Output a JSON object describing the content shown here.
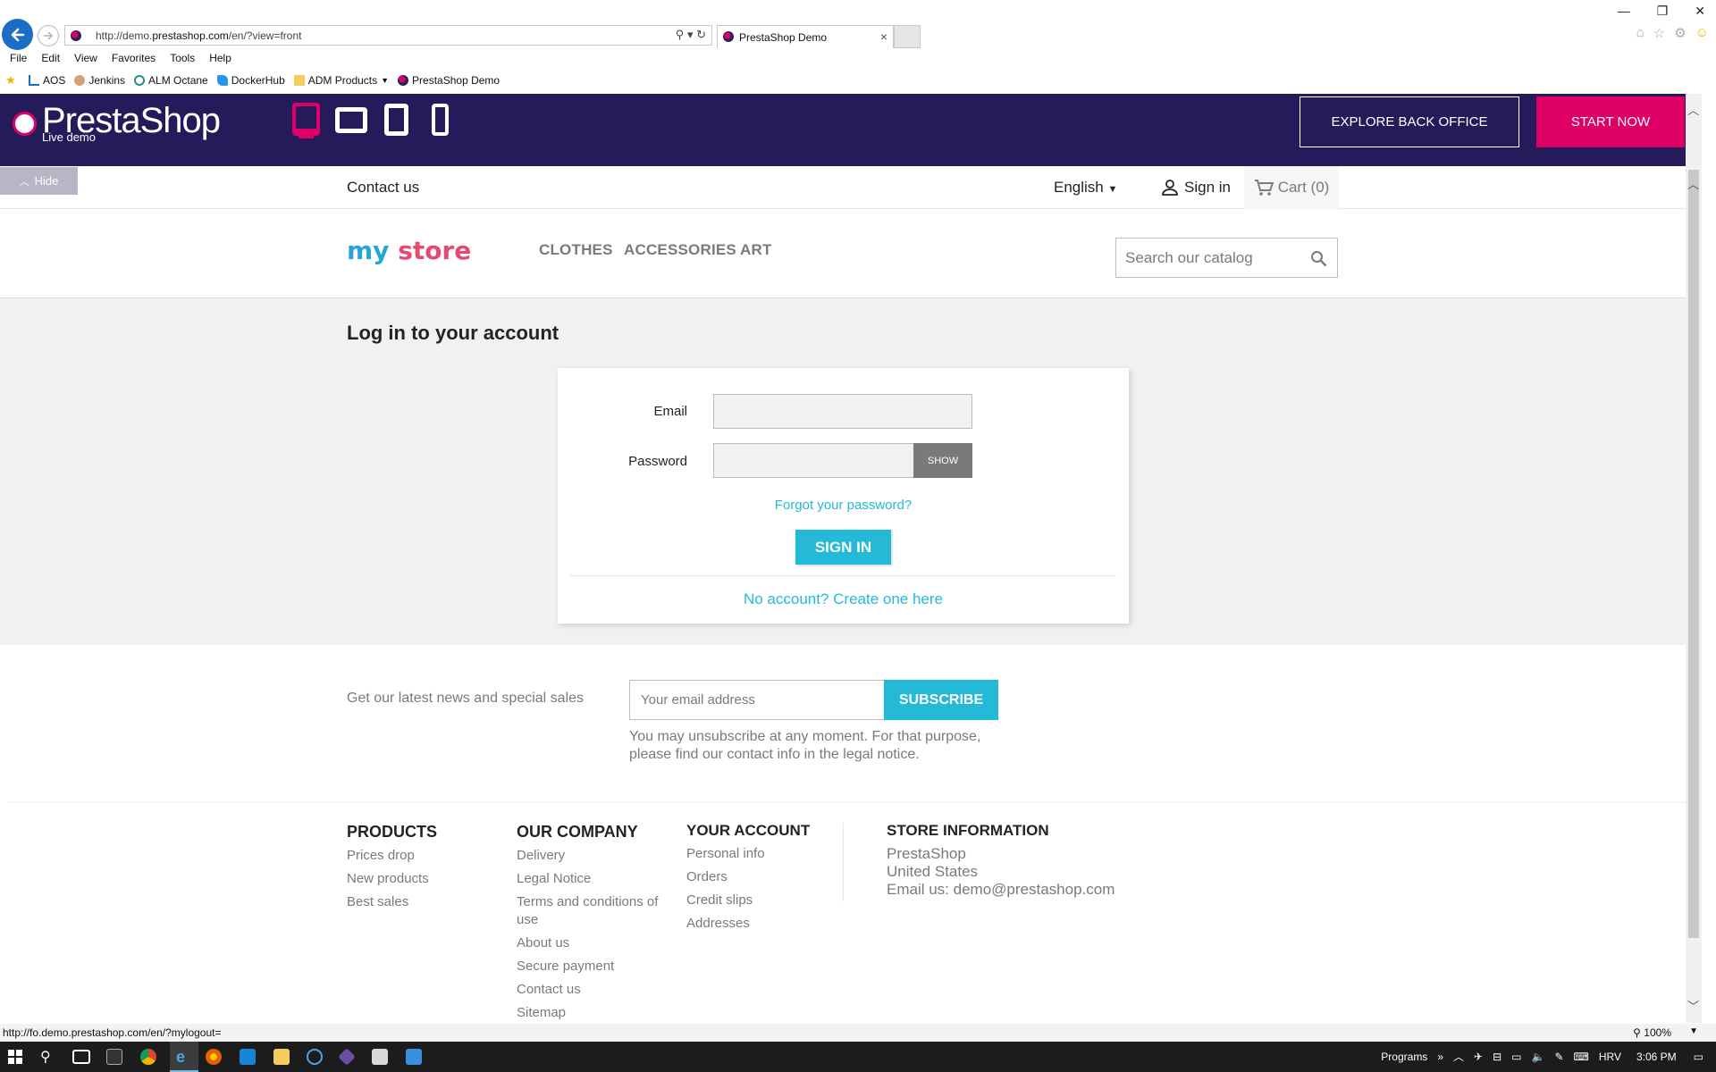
{
  "browser": {
    "url_prefix": "http://demo.",
    "url_domain": "prestashop.com",
    "url_suffix": "/en/?view=front",
    "tab_title": "PrestaShop Demo",
    "tab_close": "×",
    "menu": [
      "File",
      "Edit",
      "View",
      "Favorites",
      "Tools",
      "Help"
    ],
    "favorites": [
      {
        "label": "AOS",
        "icon": "aos-icon"
      },
      {
        "label": "Jenkins",
        "icon": "jenkins-icon"
      },
      {
        "label": "ALM Octane",
        "icon": "octane-icon"
      },
      {
        "label": "DockerHub",
        "icon": "docker-icon"
      },
      {
        "label": "ADM Products",
        "icon": "folder-icon"
      },
      {
        "label": "PrestaShop Demo",
        "icon": "prestashop-icon"
      }
    ],
    "status_url": "http://fo.demo.prestashop.com/en/?mylogout=",
    "zoom": "100%"
  },
  "demo_header": {
    "logo": "PrestaShop",
    "subtitle": "Live demo",
    "explore_label": "EXPLORE BACK OFFICE",
    "start_label": "START NOW",
    "hide_label": "Hide",
    "accent": "#df0067",
    "background": "#251b5b"
  },
  "store": {
    "contact_label": "Contact us",
    "language": "English",
    "signin_label": "Sign in",
    "cart_label": "Cart (0)",
    "logo_parts": [
      "my",
      "store"
    ],
    "categories": [
      "CLOTHES",
      "ACCESSORIES",
      "ART"
    ],
    "search_placeholder": "Search our catalog",
    "accent": "#24b9d7"
  },
  "login": {
    "title": "Log in to your account",
    "email_label": "Email",
    "email_value": "",
    "password_label": "Password",
    "password_value": "",
    "show_label": "SHOW",
    "forgot_label": "Forgot your password?",
    "signin_button": "SIGN IN",
    "create_label": "No account? Create one here"
  },
  "newsletter": {
    "text": "Get our latest news and special sales",
    "placeholder": "Your email address",
    "button": "SUBSCRIBE",
    "note": "You may unsubscribe at any moment. For that purpose, please find our contact info in the legal notice."
  },
  "footer": {
    "products": {
      "title": "PRODUCTS",
      "links": [
        "Prices drop",
        "New products",
        "Best sales"
      ]
    },
    "company": {
      "title": "OUR COMPANY",
      "links": [
        "Delivery",
        "Legal Notice",
        "Terms and conditions of use",
        "About us",
        "Secure payment",
        "Contact us",
        "Sitemap"
      ]
    },
    "account": {
      "title": "YOUR ACCOUNT",
      "links": [
        "Personal info",
        "Orders",
        "Credit slips",
        "Addresses"
      ]
    },
    "store_info": {
      "title": "STORE INFORMATION",
      "lines": [
        "PrestaShop",
        "United States",
        "Email us: demo@prestashop.com"
      ]
    }
  },
  "taskbar": {
    "programs": "Programs",
    "language": "HRV",
    "time": "3:06 PM"
  }
}
